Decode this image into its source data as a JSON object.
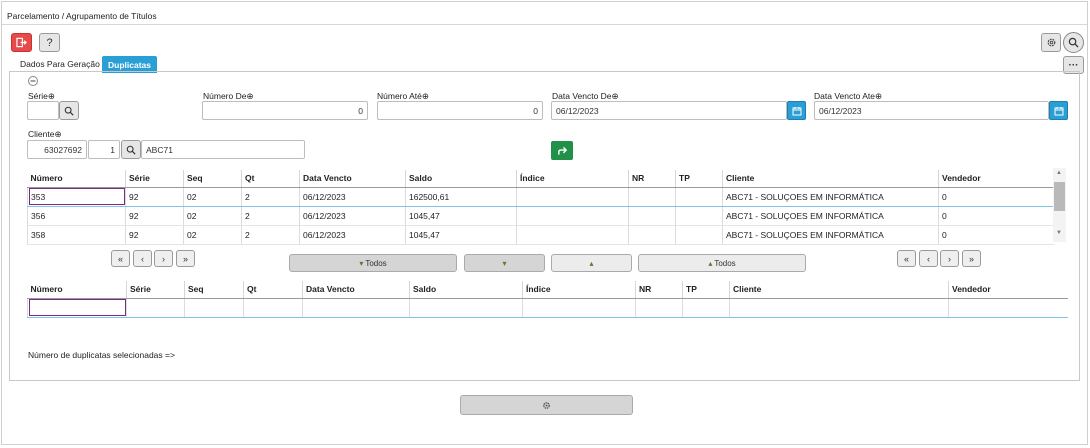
{
  "window": {
    "title": "Parcelamento / Agrupamento de Títulos"
  },
  "toolbar": {
    "exit_icon": "exit-icon",
    "help_label": "?"
  },
  "tabs": [
    {
      "label": "Dados Para Geração"
    },
    {
      "label": "Duplicatas"
    }
  ],
  "filters": {
    "serie_label": "Série",
    "numero_de_label": "Número De",
    "numero_de_value": "0",
    "numero_ate_label": "Número Até",
    "numero_ate_value": "0",
    "data_de_label": "Data Vencto De",
    "data_de_value": "06/12/2023",
    "data_ate_label": "Data Vencto Ate",
    "data_ate_value": "06/12/2023",
    "cliente_label": "Cliente",
    "cliente_code": "63027692",
    "cliente_loja": "1",
    "cliente_name": "ABC71"
  },
  "grid1": {
    "columns": [
      "Número",
      "Série",
      "Seq",
      "Qt",
      "Data Vencto",
      "Saldo",
      "Índice",
      "NR",
      "TP",
      "Cliente",
      "Vendedor"
    ],
    "rows": [
      [
        "353",
        "92",
        "02",
        "2",
        "06/12/2023",
        "162500,61",
        "",
        "",
        "",
        "ABC71 - SOLUÇOES EM INFORMÁTICA",
        "0"
      ],
      [
        "356",
        "92",
        "02",
        "2",
        "06/12/2023",
        "1045,47",
        "",
        "",
        "",
        "ABC71 - SOLUÇOES EM INFORMÁTICA",
        "0"
      ],
      [
        "358",
        "92",
        "02",
        "2",
        "06/12/2023",
        "1045,47",
        "",
        "",
        "",
        "ABC71 - SOLUÇOES EM INFORMÁTICA",
        "0"
      ]
    ]
  },
  "navigation": {
    "first": "«",
    "prev": "‹",
    "next": "›",
    "last": "»"
  },
  "transfer": {
    "all_down_label": "Todos",
    "all_up_label": "Todos"
  },
  "grid2": {
    "columns": [
      "Número",
      "Série",
      "Seq",
      "Qt",
      "Data Vencto",
      "Saldo",
      "Índice",
      "NR",
      "TP",
      "Cliente",
      "Vendedor"
    ]
  },
  "status": {
    "selected_count_label": "Número de duplicatas selecionadas =>"
  },
  "colors": {
    "accent": "#2a9fd6",
    "danger": "#e84a4a",
    "go": "#21914a",
    "focus": "#7a2a86"
  }
}
